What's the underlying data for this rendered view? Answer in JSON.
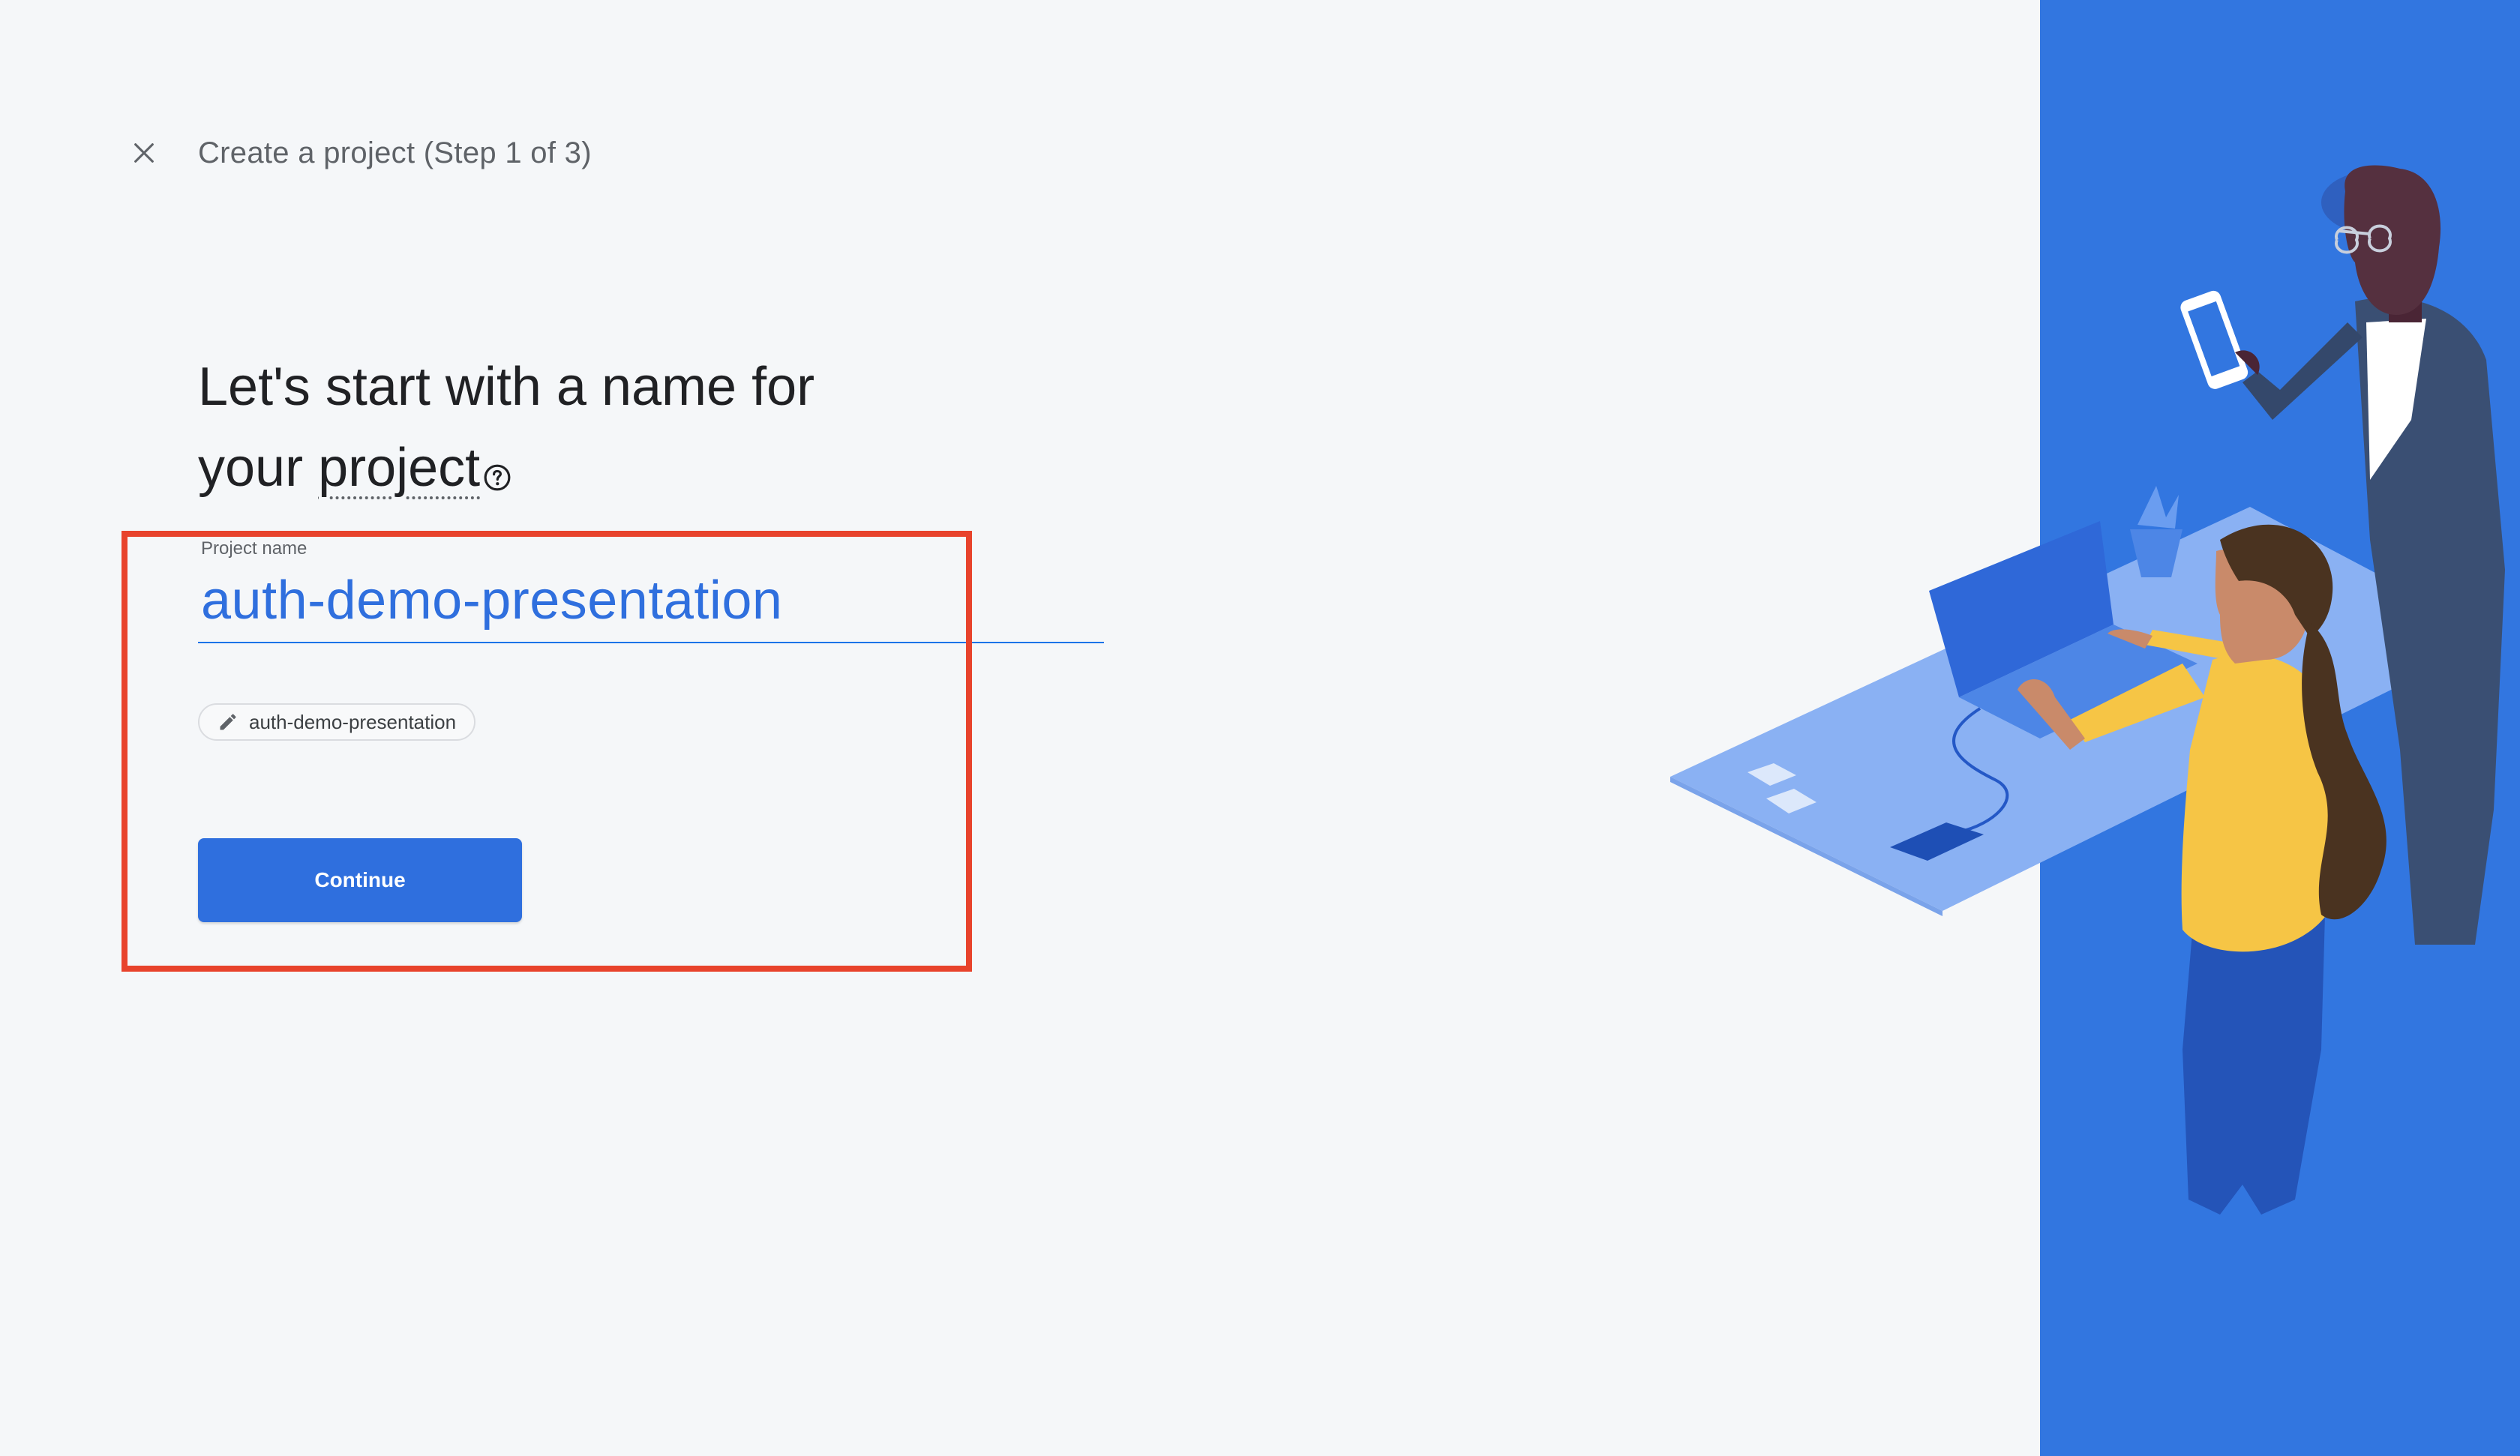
{
  "header": {
    "close_icon": "close-icon",
    "title": "Create a project (Step 1 of 3)"
  },
  "heading": {
    "line1": "Let's start with a name for",
    "line2_prefix": "your ",
    "term": "project",
    "help_icon": "help-circle-icon"
  },
  "project_name": {
    "label": "Project name",
    "value": "auth-demo-presentation"
  },
  "project_id_chip": {
    "icon": "pencil-icon",
    "value": "auth-demo-presentation"
  },
  "continue_label": "Continue",
  "colors": {
    "accent": "#2f6fde",
    "side_panel": "#3276e0",
    "highlight": "#e8432c",
    "background": "#f5f7f9"
  }
}
